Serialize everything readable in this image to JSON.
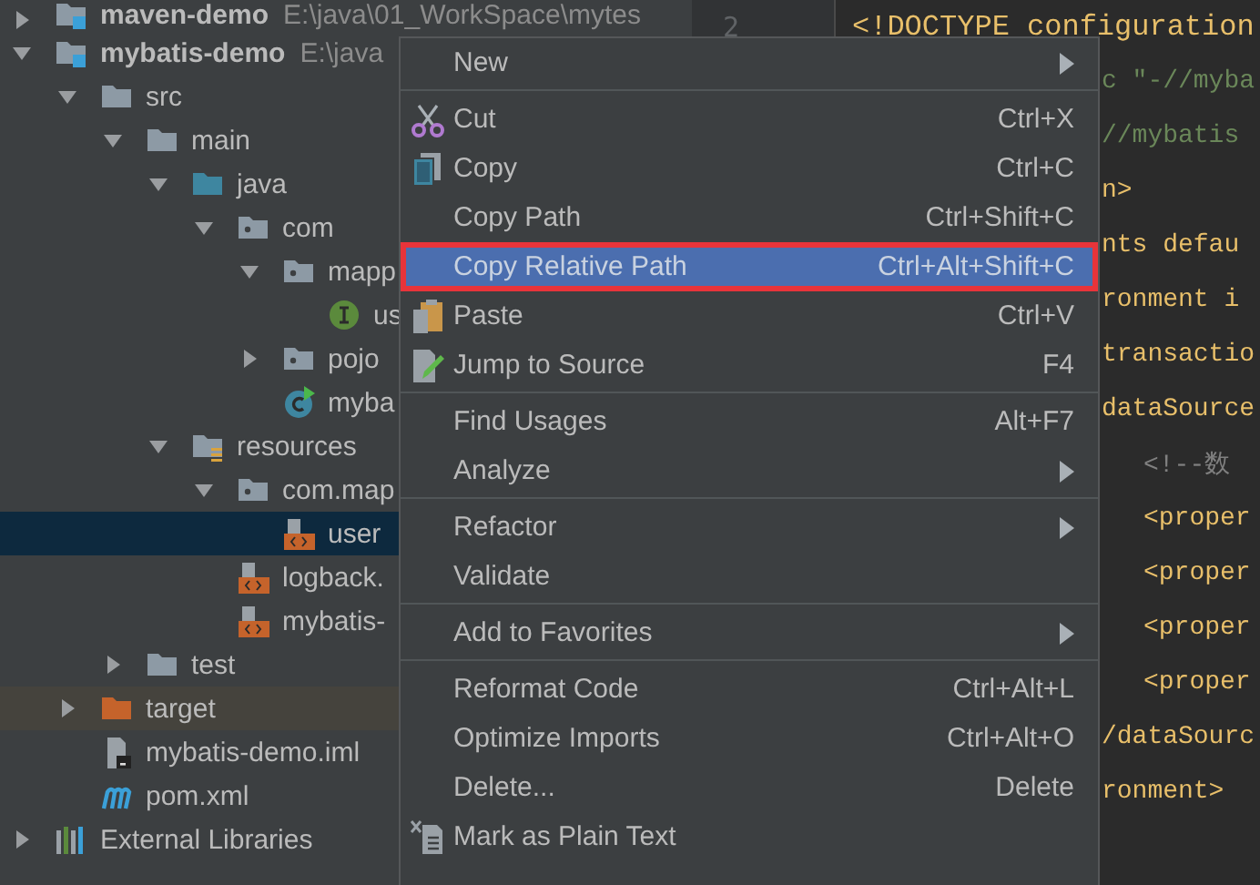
{
  "project_tree": [
    {
      "label": "maven-demo",
      "path": "E:\\java\\01_WorkSpace\\mytes",
      "kind": "module",
      "expanded": false,
      "selected": false
    },
    {
      "label": "mybatis-demo",
      "path": "E:\\java",
      "kind": "module",
      "expanded": true,
      "selected": false,
      "children": [
        {
          "label": "src",
          "kind": "folder",
          "expanded": true,
          "selected": false,
          "children": [
            {
              "label": "main",
              "kind": "folder",
              "expanded": true,
              "selected": false,
              "children": [
                {
                  "label": "java",
                  "kind": "source-folder",
                  "expanded": true,
                  "selected": false,
                  "children": [
                    {
                      "label": "com",
                      "kind": "package",
                      "expanded": true,
                      "selected": false,
                      "children": [
                        {
                          "label": "mapp",
                          "kind": "package",
                          "expanded": true,
                          "selected": false,
                          "children": [
                            {
                              "label": "us",
                              "kind": "interface",
                              "selected": false
                            }
                          ]
                        },
                        {
                          "label": "pojo",
                          "kind": "package",
                          "expanded": false,
                          "selected": false
                        },
                        {
                          "label": "myba",
                          "kind": "class",
                          "selected": false
                        }
                      ]
                    }
                  ]
                },
                {
                  "label": "resources",
                  "kind": "resources-folder",
                  "expanded": true,
                  "selected": false,
                  "children": [
                    {
                      "label": "com.map",
                      "kind": "package",
                      "expanded": true,
                      "selected": false,
                      "children": [
                        {
                          "label": "user",
                          "kind": "xml",
                          "selected": true
                        }
                      ]
                    },
                    {
                      "label": "logback.",
                      "kind": "xml",
                      "selected": false
                    },
                    {
                      "label": "mybatis-",
                      "kind": "xml",
                      "selected": false
                    }
                  ]
                }
              ]
            },
            {
              "label": "test",
              "kind": "folder",
              "expanded": false,
              "selected": false
            }
          ]
        },
        {
          "label": "target",
          "kind": "excluded-folder",
          "expanded": false,
          "selected": false
        },
        {
          "label": "mybatis-demo.iml",
          "kind": "iml",
          "selected": false
        },
        {
          "label": "pom.xml",
          "kind": "maven",
          "selected": false
        }
      ]
    },
    {
      "label": "External Libraries",
      "kind": "libraries",
      "expanded": false,
      "selected": false
    }
  ],
  "editor": {
    "lines": [
      {
        "line_number": "2",
        "text": "<!DOCTYPE configuration",
        "kind": "doctype",
        "nested": false
      },
      {
        "text": "c \"-//myba",
        "kind": "string",
        "nested": false
      },
      {
        "text": " //mybatis",
        "kind": "string",
        "nested": false
      },
      {
        "text": "n>",
        "kind": "tag",
        "nested": false
      },
      {
        "text": "nts defau",
        "kind": "tag",
        "nested": false
      },
      {
        "text": "ronment i",
        "kind": "tag",
        "nested": false
      },
      {
        "text": "transactio",
        "kind": "tag",
        "nested": false
      },
      {
        "text": "dataSource",
        "kind": "tag",
        "nested": false
      },
      {
        "text": "<!--数",
        "kind": "comment",
        "nested": true
      },
      {
        "text": "<proper",
        "kind": "tag",
        "nested": true
      },
      {
        "text": "<proper",
        "kind": "tag",
        "nested": true
      },
      {
        "text": "<proper",
        "kind": "tag",
        "nested": true
      },
      {
        "text": "<proper",
        "kind": "tag",
        "nested": true
      },
      {
        "text": "/dataSourc",
        "kind": "tag",
        "nested": false
      },
      {
        "text": "ronment>",
        "kind": "tag",
        "nested": false
      }
    ]
  },
  "context_menu": {
    "groups": [
      [
        {
          "label": "New",
          "submenu": true,
          "selected": false
        }
      ],
      [
        {
          "label": "Cut",
          "shortcut": "Ctrl+X",
          "selected": false
        },
        {
          "label": "Copy",
          "shortcut": "Ctrl+C",
          "selected": false
        },
        {
          "label": "Copy Path",
          "shortcut": "Ctrl+Shift+C",
          "selected": false
        },
        {
          "label": "Copy Relative Path",
          "shortcut": "Ctrl+Alt+Shift+C",
          "selected": true
        },
        {
          "label": "Paste",
          "shortcut": "Ctrl+V",
          "selected": false
        },
        {
          "label": "Jump to Source",
          "shortcut": "F4",
          "selected": false
        }
      ],
      [
        {
          "label": "Find Usages",
          "shortcut": "Alt+F7",
          "selected": false
        },
        {
          "label": "Analyze",
          "submenu": true,
          "selected": false
        }
      ],
      [
        {
          "label": "Refactor",
          "submenu": true,
          "selected": false
        },
        {
          "label": "Validate",
          "selected": false
        }
      ],
      [
        {
          "label": "Add to Favorites",
          "submenu": true,
          "selected": false
        }
      ],
      [
        {
          "label": "Reformat Code",
          "shortcut": "Ctrl+Alt+L",
          "selected": false
        },
        {
          "label": "Optimize Imports",
          "shortcut": "Ctrl+Alt+O",
          "selected": false
        },
        {
          "label": "Delete...",
          "shortcut": "Delete",
          "selected": false
        },
        {
          "label": "Mark as Plain Text",
          "selected": false
        }
      ]
    ]
  }
}
